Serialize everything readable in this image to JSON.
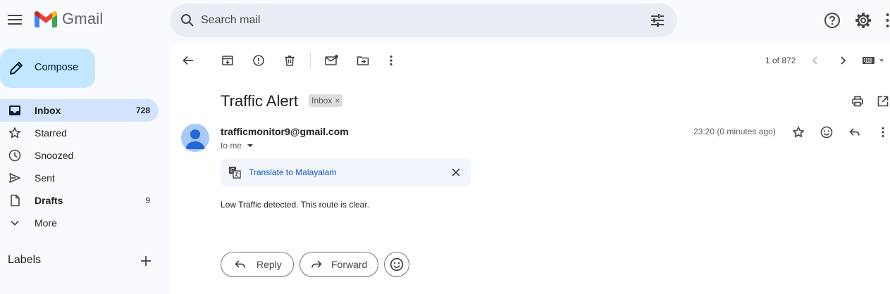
{
  "header": {
    "app_name": "Gmail",
    "search_placeholder": "Search mail",
    "icons": [
      "menu-icon",
      "gmail-logo",
      "search-icon",
      "tune-icon",
      "help-icon",
      "gear-icon",
      "apps-icon"
    ]
  },
  "sidebar": {
    "compose_label": "Compose",
    "items": [
      {
        "label": "Inbox",
        "count": "728",
        "icon": "inbox-icon",
        "active": true
      },
      {
        "label": "Starred",
        "count": "",
        "icon": "star-icon"
      },
      {
        "label": "Snoozed",
        "count": "",
        "icon": "clock-icon"
      },
      {
        "label": "Sent",
        "count": "",
        "icon": "send-icon"
      },
      {
        "label": "Drafts",
        "count": "9",
        "icon": "draft-icon"
      },
      {
        "label": "More",
        "count": "",
        "icon": "chevron-down-icon"
      }
    ],
    "labels_heading": "Labels"
  },
  "toolbar": {
    "pager": "1 of 872",
    "icons": [
      "back-icon",
      "archive-icon",
      "report-spam-icon",
      "delete-icon",
      "mark-unread-icon",
      "move-to-icon",
      "more-vert-icon",
      "chevron-left-icon",
      "chevron-right-icon",
      "keyboard-icon"
    ]
  },
  "message": {
    "subject": "Traffic Alert",
    "label_chip": "Inbox",
    "label_chip_close": "×",
    "sender": "trafficmonitor9@gmail.com",
    "to": "to me",
    "time": "23:20 (0 minutes ago)",
    "translate_link": "Translate to Malayalam",
    "body": "Low Traffic detected. This route is clear."
  },
  "actions": {
    "reply_label": "Reply",
    "forward_label": "Forward"
  },
  "colors": {
    "background": "#f8fafd",
    "compose": "#c2e7ff",
    "active_nav": "#d3e3fd",
    "search": "#e9eef6",
    "link": "#0b57d0"
  }
}
